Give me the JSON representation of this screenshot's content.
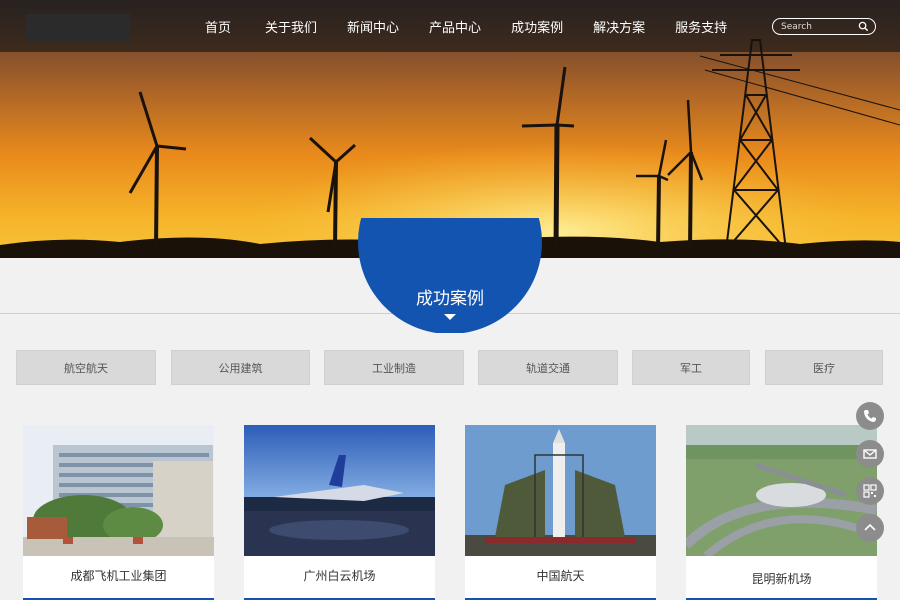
{
  "header": {
    "nav": [
      "首页",
      "关于我们",
      "新闻中心",
      "产品中心",
      "成功案例",
      "解决方案",
      "服务支持"
    ],
    "search_placeholder": "Search"
  },
  "section": {
    "title": "成功案例"
  },
  "tabs": [
    "航空航天",
    "公用建筑",
    "工业制造",
    "轨道交通",
    "军工",
    "医疗"
  ],
  "cards": [
    {
      "caption": "成都飞机工业集团"
    },
    {
      "caption": "广州白云机场"
    },
    {
      "caption": "中国航天"
    },
    {
      "caption": "昆明新机场"
    }
  ],
  "float": [
    "phone-icon",
    "mail-icon",
    "qrcode-icon",
    "back-to-top-icon"
  ],
  "colors": {
    "accent": "#1254b0",
    "header_overlay": "#141414",
    "page_bg": "#f1f1f1"
  }
}
